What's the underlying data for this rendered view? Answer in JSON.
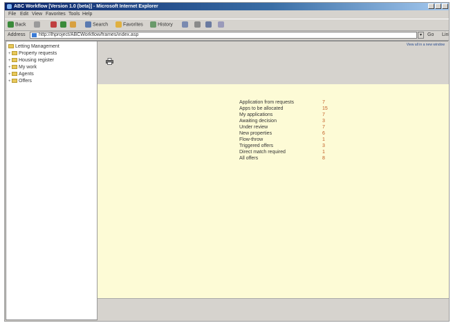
{
  "window": {
    "title": "ABC Workflow [Version 1.0 (beta)] - Microsoft Internet Explorer"
  },
  "menubar": {
    "items": [
      "File",
      "Edit",
      "View",
      "Favorites",
      "Tools",
      "Help"
    ]
  },
  "toolbar": {
    "back_label": "Back",
    "search_label": "Search",
    "favorites_label": "Favorites",
    "history_label": "History"
  },
  "addressbar": {
    "label": "Address",
    "url": "http://lhproject/ABCWorkflow/frames/index.asp",
    "go_label": "Go",
    "links_label": "Links"
  },
  "nav": {
    "items": [
      {
        "label": "Letting Management",
        "expander": ""
      },
      {
        "label": "Property requests",
        "expander": "+"
      },
      {
        "label": "Housing register",
        "expander": "+"
      },
      {
        "label": "My work",
        "expander": "+"
      },
      {
        "label": "Agents",
        "expander": "+"
      },
      {
        "label": "Offers",
        "expander": "+"
      }
    ]
  },
  "header": {
    "top_link": "View all in a new window"
  },
  "stats": [
    {
      "label": "Application from requests",
      "count": "7"
    },
    {
      "label": "Apps to be allocated",
      "count": "15"
    },
    {
      "label": "My applications",
      "count": "7"
    },
    {
      "label": "Awaiting decision",
      "count": "3"
    },
    {
      "label": "Under review",
      "count": "7"
    },
    {
      "label": "New properties",
      "count": "6"
    },
    {
      "label": "Flow-throw",
      "count": "1"
    },
    {
      "label": "Triggered offers",
      "count": "3"
    },
    {
      "label": "Direct match required",
      "count": "1"
    },
    {
      "label": "All offers",
      "count": "8"
    }
  ],
  "colors": {
    "main_background": "#fdfbd6",
    "header_background": "#d6d3ce",
    "count_text": "#c05a20",
    "titlebar_start": "#0a246a"
  }
}
